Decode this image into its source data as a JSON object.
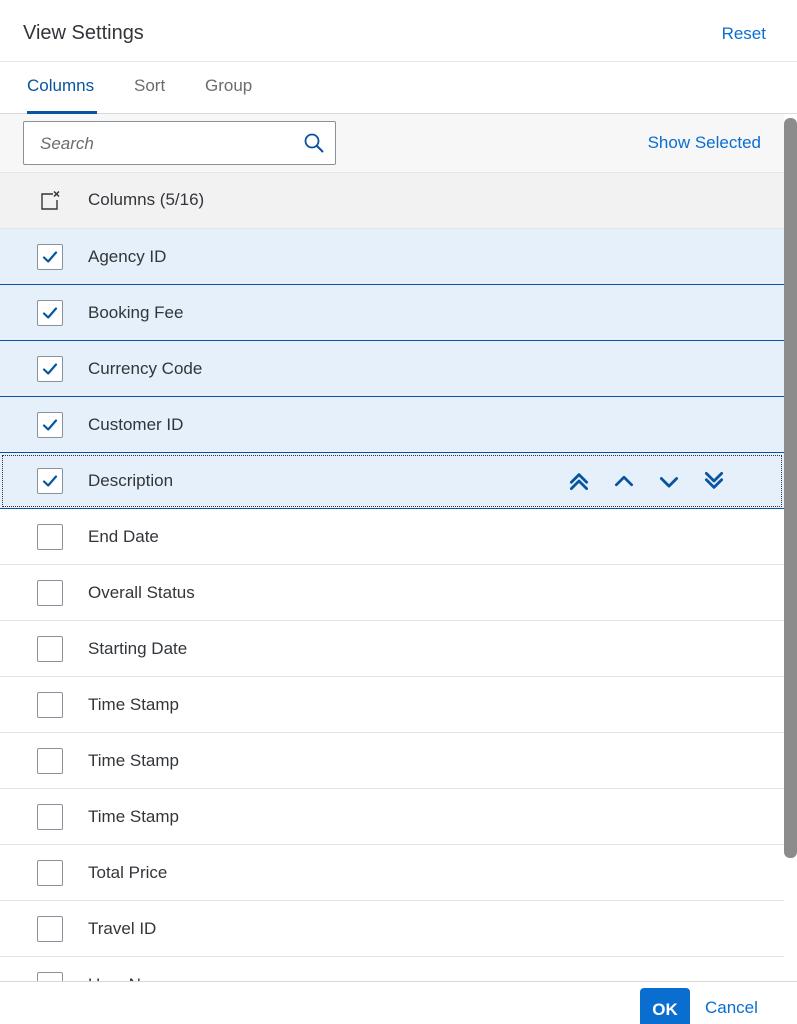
{
  "dialog": {
    "title": "View Settings",
    "reset_label": "Reset"
  },
  "tabs": [
    {
      "label": "Columns",
      "selected": true
    },
    {
      "label": "Sort",
      "selected": false
    },
    {
      "label": "Group",
      "selected": false
    }
  ],
  "toolbar": {
    "search_placeholder": "Search",
    "search_value": "",
    "search_icon": "search-icon",
    "show_selected_label": "Show Selected"
  },
  "list_header": {
    "label": "Columns (5/16)",
    "icon": "deselect-all-icon"
  },
  "columns": [
    {
      "label": "Agency ID",
      "checked": true
    },
    {
      "label": "Booking Fee",
      "checked": true
    },
    {
      "label": "Currency Code",
      "checked": true
    },
    {
      "label": "Customer ID",
      "checked": true
    },
    {
      "label": "Description",
      "checked": true,
      "focused": true
    },
    {
      "label": "End Date",
      "checked": false
    },
    {
      "label": "Overall Status",
      "checked": false
    },
    {
      "label": "Starting Date",
      "checked": false
    },
    {
      "label": "Time Stamp",
      "checked": false
    },
    {
      "label": "Time Stamp",
      "checked": false
    },
    {
      "label": "Time Stamp",
      "checked": false
    },
    {
      "label": "Total Price",
      "checked": false
    },
    {
      "label": "Travel ID",
      "checked": false
    },
    {
      "label": "User Name",
      "checked": false
    }
  ],
  "move_buttons": [
    "move-to-top-icon",
    "move-up-icon",
    "move-down-icon",
    "move-to-bottom-icon"
  ],
  "footer": {
    "ok_label": "OK",
    "cancel_label": "Cancel"
  },
  "colors": {
    "accent": "#0a6ed1",
    "selected_row_bg": "#e5f0fa",
    "selected_row_border": "#0854a0"
  }
}
